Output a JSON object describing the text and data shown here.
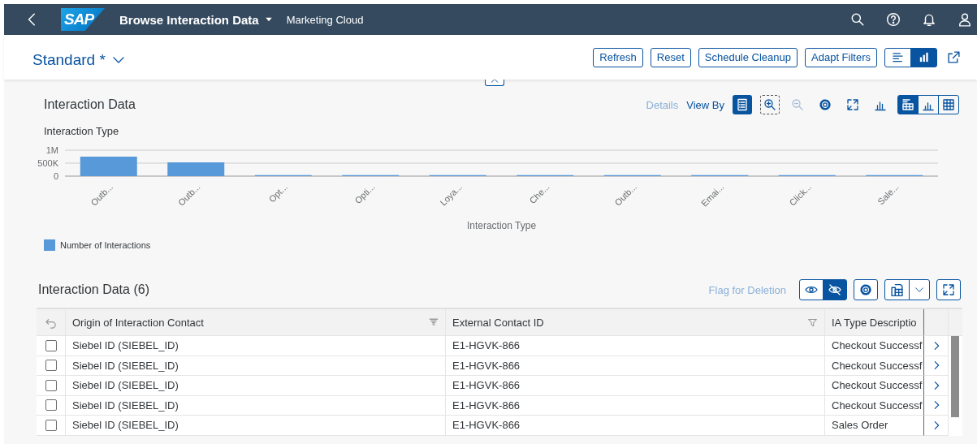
{
  "shell": {
    "title": "Browse Interaction Data",
    "subtitle": "Marketing Cloud",
    "logo": "SAP"
  },
  "header": {
    "variant": "Standard *",
    "actions": [
      {
        "label": "Refresh"
      },
      {
        "label": "Reset"
      },
      {
        "label": "Schedule Cleanup"
      },
      {
        "label": "Adapt Filters"
      }
    ],
    "view_toggle": [
      {
        "kind": "filter-bar",
        "selected": false
      },
      {
        "kind": "chart",
        "selected": true
      }
    ]
  },
  "chart_card": {
    "title": "Interaction Data",
    "details": {
      "label": "Details",
      "disabled": true
    },
    "view_by": "View By",
    "tools": [
      {
        "kind": "legend",
        "pressed": true,
        "disabled": false,
        "focused": false
      },
      {
        "kind": "zoom-in",
        "pressed": false,
        "disabled": false,
        "focused": true
      },
      {
        "kind": "zoom-out",
        "pressed": false,
        "disabled": true,
        "focused": false
      },
      {
        "kind": "settings",
        "pressed": false,
        "disabled": false,
        "focused": false
      },
      {
        "kind": "fullscreen",
        "pressed": false,
        "disabled": false,
        "focused": false
      },
      {
        "kind": "chart-type",
        "pressed": false,
        "disabled": false,
        "focused": false
      }
    ],
    "view_modes": [
      {
        "kind": "chart-table",
        "selected": true
      },
      {
        "kind": "chart",
        "selected": false
      },
      {
        "kind": "table",
        "selected": false
      }
    ],
    "chart_data": {
      "type": "bar",
      "title": "Interaction Type",
      "xlabel": "Interaction Type",
      "categories": [
        "Outb...",
        "Outb...",
        "Opt...",
        "Opti...",
        "Loya...",
        "Che...",
        "Outb...",
        "Emai...",
        "Click...",
        "Sale..."
      ],
      "series": [
        {
          "name": "Number of Interactions",
          "color": "#5899da",
          "values": [
            750000,
            530000,
            40000,
            40000,
            40000,
            40000,
            40000,
            40000,
            40000,
            40000
          ]
        }
      ],
      "ylim": [
        0,
        1000000
      ],
      "yticks": [
        {
          "value": 0,
          "label": "0"
        },
        {
          "value": 500000,
          "label": "500K"
        },
        {
          "value": 1000000,
          "label": "1M"
        }
      ]
    }
  },
  "table": {
    "title": "Interaction Data (6)",
    "flag": {
      "label": "Flag for Deletion",
      "disabled": true
    },
    "visibility_toggle": [
      {
        "kind": "show",
        "selected": false
      },
      {
        "kind": "hide",
        "selected": true
      }
    ],
    "columns": [
      "Origin of Interaction Contact",
      "External Contact ID",
      "IA Type Descriptio"
    ],
    "rows": [
      {
        "checked": false,
        "cells": [
          "Siebel ID (SIEBEL_ID)",
          "E1-HGVK-866",
          "Checkout Successf"
        ]
      },
      {
        "checked": false,
        "cells": [
          "Siebel ID (SIEBEL_ID)",
          "E1-HGVK-866",
          "Checkout Successf"
        ]
      },
      {
        "checked": false,
        "cells": [
          "Siebel ID (SIEBEL_ID)",
          "E1-HGVK-866",
          "Checkout Successf"
        ]
      },
      {
        "checked": false,
        "cells": [
          "Siebel ID (SIEBEL_ID)",
          "E1-HGVK-866",
          "Checkout Successf"
        ]
      },
      {
        "checked": false,
        "cells": [
          "Siebel ID (SIEBEL_ID)",
          "E1-HGVK-866",
          "Sales Order"
        ]
      }
    ]
  }
}
